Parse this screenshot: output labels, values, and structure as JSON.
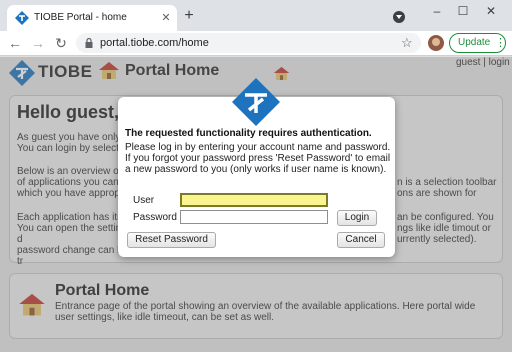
{
  "browser": {
    "tab_title": "TIOBE Portal - home",
    "tab_close": "✕",
    "new_tab": "+",
    "url": "portal.tiobe.com/home",
    "update_label": "Update",
    "minimize": "–",
    "maximize": "☐",
    "close": "✕"
  },
  "page": {
    "logo_text": "TIOBE",
    "heading": "Portal Home",
    "guest_links": "guest | login",
    "hello": "Hello guest,",
    "para1": "As guest you have only\nYou can login by selecti",
    "para2_left": "Below is an overview of\nof applications you can\nwhich you have appropr",
    "para2_right": "n is a selection toolbar\nons are shown for",
    "para3_left": "Each application has its\nYou can open the settings d\npassword change can be tr",
    "para3_right": "an be configured. You\nngs like idle timout or\nurrently selected).",
    "portal_title": "Portal Home",
    "portal_desc": "Entrance page of the portal showing an overview of the available applications. Here portal wide user settings, like idle timeout, can be set as well."
  },
  "dialog": {
    "heading": "The requested functionality requires authentication.",
    "text": "Please log in by entering your account name and password. If you forgot your password press 'Reset Password' to email a new password to you (only works if user name is known).",
    "user_label": "User",
    "user_value": "",
    "password_label": "Password",
    "password_value": "",
    "login_label": "Login",
    "reset_label": "Reset Password",
    "cancel_label": "Cancel"
  },
  "colors": {
    "brand_blue": "#1e73be",
    "update_green": "#1e8e3e",
    "focus_yellow": "#fbf58f"
  }
}
